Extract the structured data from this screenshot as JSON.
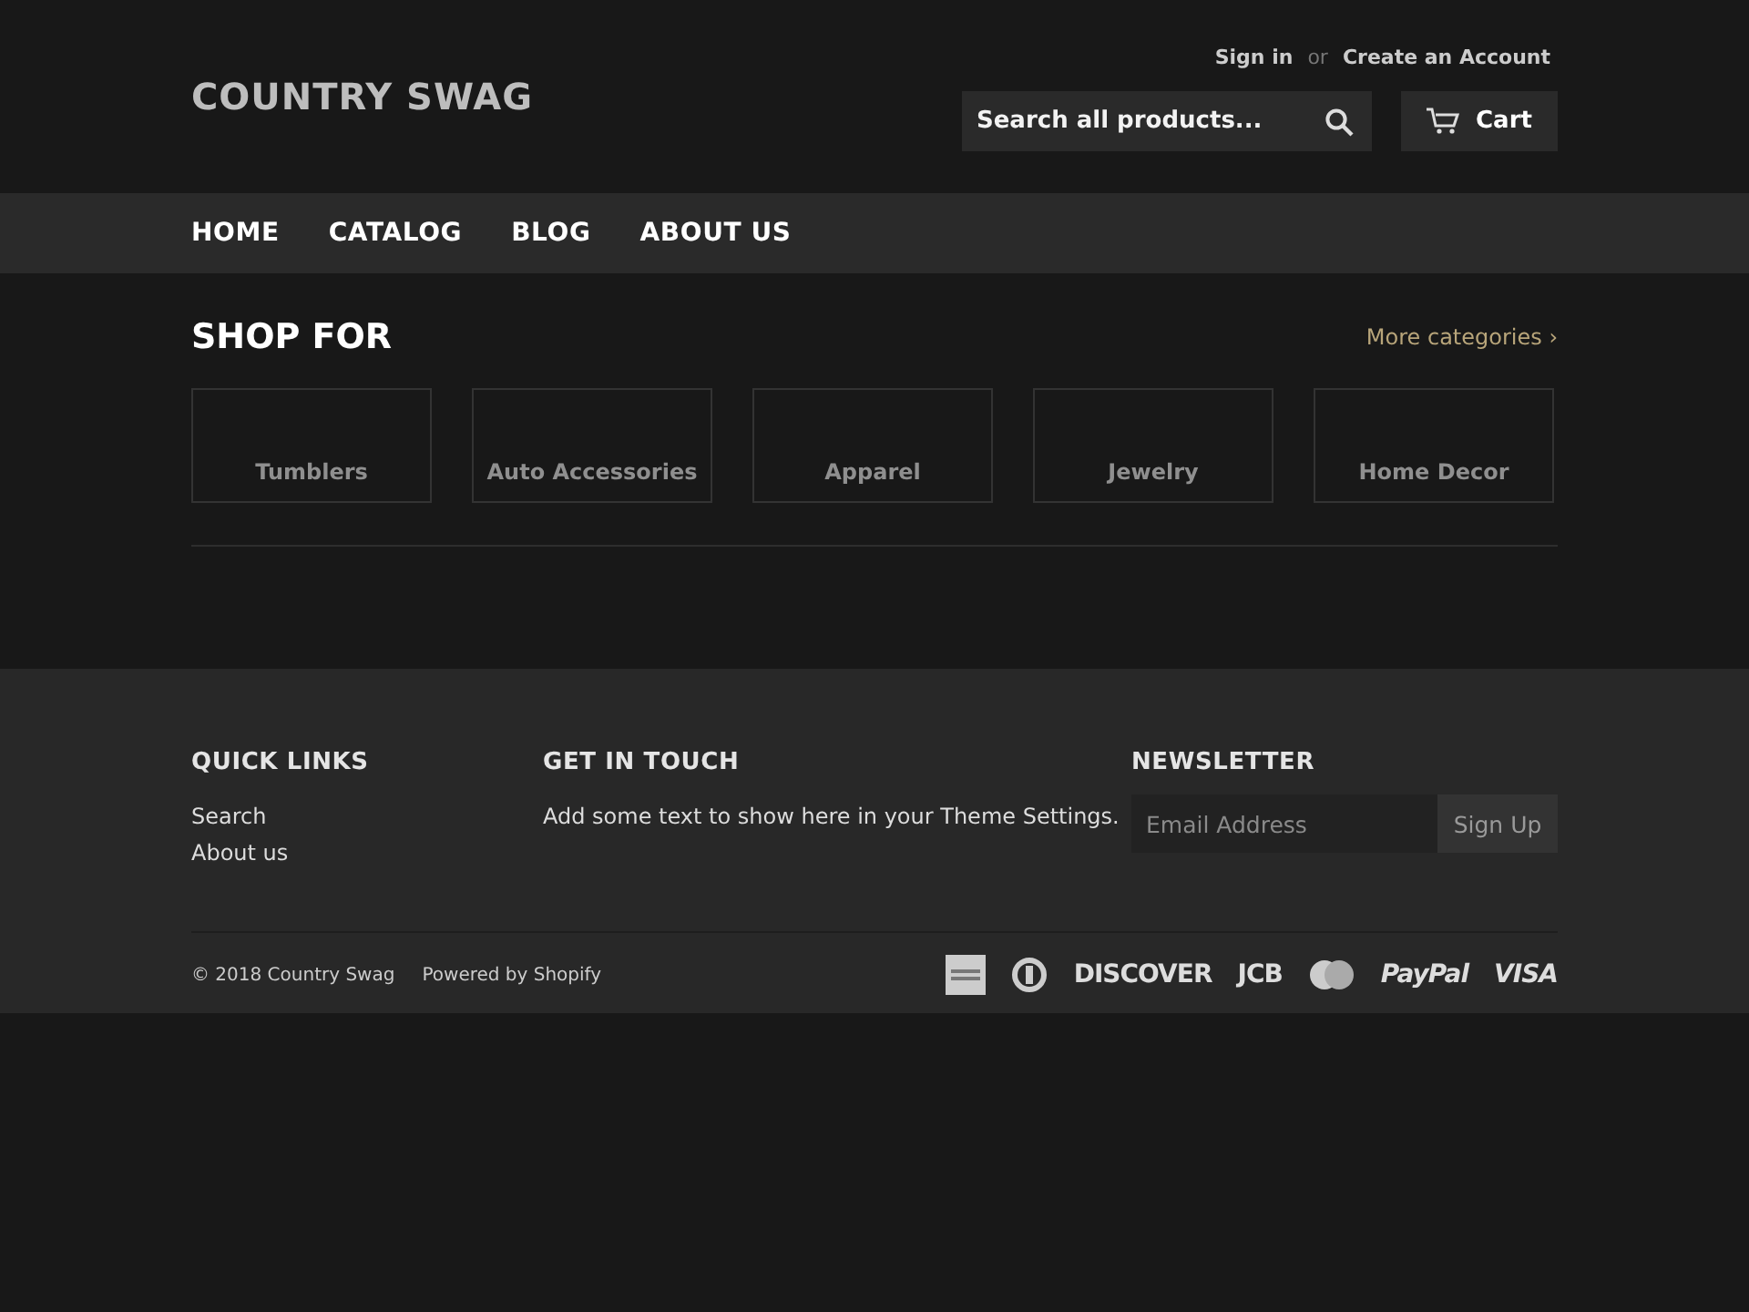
{
  "header": {
    "logo": "COUNTRY SWAG",
    "account_links": {
      "sign_in": "Sign in",
      "separator": "or",
      "create": "Create an Account"
    },
    "search": {
      "placeholder": "Search all products..."
    },
    "cart": {
      "label": "Cart"
    }
  },
  "nav": [
    "HOME",
    "CATALOG",
    "BLOG",
    "ABOUT US"
  ],
  "shop_for": {
    "title": "SHOP FOR",
    "more": "More categories ›",
    "categories": [
      "Tumblers",
      "Auto Accessories",
      "Apparel",
      "Jewelry",
      "Home Decor"
    ]
  },
  "footer": {
    "quick_links": {
      "title": "QUICK LINKS",
      "links": [
        "Search",
        "About us"
      ]
    },
    "get_in_touch": {
      "title": "GET IN TOUCH",
      "text": "Add some text to show here in your Theme Settings."
    },
    "newsletter": {
      "title": "NEWSLETTER",
      "placeholder": "Email Address",
      "button": "Sign Up"
    },
    "copyright": "© 2018 Country Swag",
    "powered": "Powered by Shopify",
    "payments": [
      {
        "kind": "card"
      },
      {
        "kind": "ring"
      },
      {
        "kind": "word",
        "label": "DISCOVER"
      },
      {
        "kind": "word",
        "label": "JCB"
      },
      {
        "kind": "circles"
      },
      {
        "kind": "italic",
        "label": "PayPal"
      },
      {
        "kind": "italic",
        "label": "VISA"
      }
    ]
  }
}
